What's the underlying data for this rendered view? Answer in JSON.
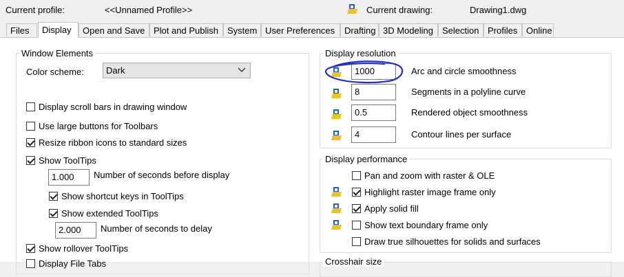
{
  "header": {
    "current_profile_label": "Current profile:",
    "current_profile_value": "<<Unnamed Profile>>",
    "current_drawing_label": "Current drawing:",
    "current_drawing_value": "Drawing1.dwg"
  },
  "tabs": [
    {
      "label": "Files"
    },
    {
      "label": "Display",
      "active": true
    },
    {
      "label": "Open and Save"
    },
    {
      "label": "Plot and Publish"
    },
    {
      "label": "System"
    },
    {
      "label": "User Preferences"
    },
    {
      "label": "Drafting"
    },
    {
      "label": "3D Modeling"
    },
    {
      "label": "Selection"
    },
    {
      "label": "Profiles"
    },
    {
      "label": "Online"
    }
  ],
  "window_elements": {
    "title": "Window Elements",
    "color_scheme_label": "Color scheme:",
    "color_scheme_value": "Dark",
    "scroll_bars": {
      "label": "Display scroll bars in drawing window",
      "checked": false
    },
    "large_buttons": {
      "label": "Use large buttons for Toolbars",
      "checked": false
    },
    "resize_ribbon": {
      "label": "Resize ribbon icons to standard sizes",
      "checked": true
    },
    "show_tooltips": {
      "label": "Show ToolTips",
      "checked": true
    },
    "seconds_before_display_value": "1.000",
    "seconds_before_display_label": "Number of seconds before display",
    "shortcut_keys": {
      "label": "Show shortcut keys in ToolTips",
      "checked": true
    },
    "extended_tooltips": {
      "label": "Show extended ToolTips",
      "checked": true
    },
    "seconds_to_delay_value": "2.000",
    "seconds_to_delay_label": "Number of seconds to delay",
    "rollover_tooltips": {
      "label": "Show rollover ToolTips",
      "checked": true
    },
    "partial_next": {
      "label": "Display File Tabs",
      "checked": false
    }
  },
  "display_resolution": {
    "title": "Display resolution",
    "items": [
      {
        "value": "1000",
        "label": "Arc and circle smoothness"
      },
      {
        "value": "8",
        "label": "Segments in a polyline curve"
      },
      {
        "value": "0.5",
        "label": "Rendered object smoothness"
      },
      {
        "value": "4",
        "label": "Contour lines per surface"
      }
    ]
  },
  "display_performance": {
    "title": "Display performance",
    "items": [
      {
        "label": "Pan and zoom with raster & OLE",
        "checked": false,
        "icon": false
      },
      {
        "label": "Highlight raster image frame only",
        "checked": true,
        "icon": true
      },
      {
        "label": "Apply solid fill",
        "checked": true,
        "icon": true
      },
      {
        "label": "Show text boundary frame only",
        "checked": false,
        "icon": true
      },
      {
        "label": "Draw true silhouettes for solids and surfaces",
        "checked": false,
        "icon": false
      }
    ]
  },
  "crosshair": {
    "title": "Crosshair size"
  },
  "colors": {
    "annotation": "#1f2fd0",
    "icon_blue": "#1e64c8",
    "icon_yellow": "#f2c21b"
  }
}
